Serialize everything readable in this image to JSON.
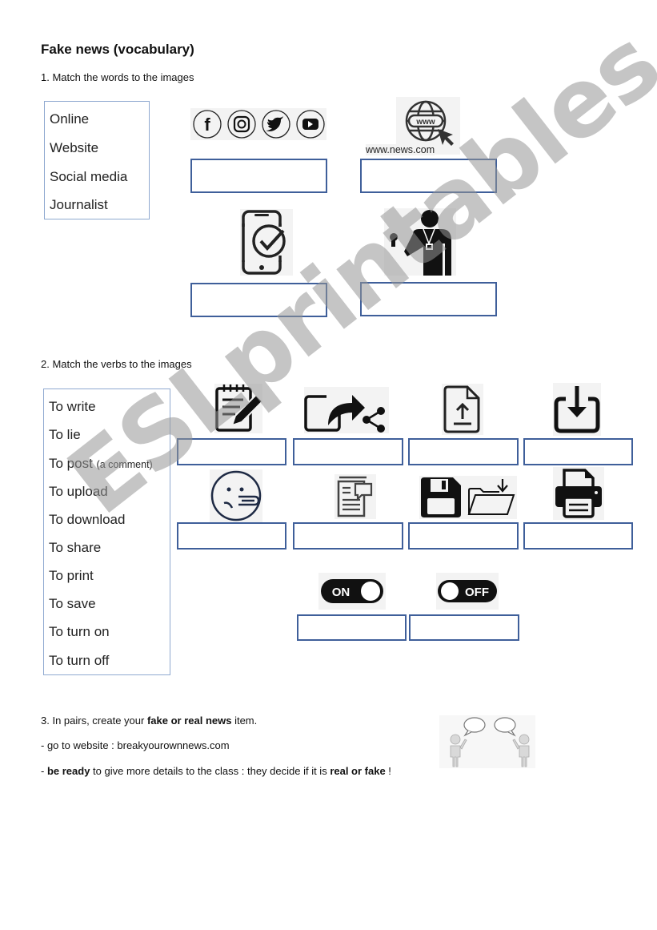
{
  "title": "Fake news (vocabulary)",
  "section1": {
    "instruction": "1. Match the words to the images",
    "words": [
      "Online",
      "Website",
      "Social media",
      "Journalist"
    ],
    "images": [
      {
        "icon": "social-media-icons",
        "caption": ""
      },
      {
        "icon": "www-globe-cursor-icon",
        "caption": "www.news.com"
      },
      {
        "icon": "phone-check-icon",
        "caption": ""
      },
      {
        "icon": "journalist-microphone-icon",
        "caption": ""
      }
    ]
  },
  "section2": {
    "instruction": "2. Match the verbs to the images",
    "verbs": [
      "To write",
      "To lie",
      "To post",
      "To upload",
      "To download",
      "To share",
      "To print",
      "To save",
      "To turn on",
      "To turn off"
    ],
    "post_note": "(a comment)",
    "images": [
      {
        "icon": "notepad-pencil-icon"
      },
      {
        "icon": "share-arrow-icon"
      },
      {
        "icon": "file-upload-icon"
      },
      {
        "icon": "download-tray-icon"
      },
      {
        "icon": "lying-face-icon"
      },
      {
        "icon": "document-comment-icon"
      },
      {
        "icon": "floppy-folder-save-icon"
      },
      {
        "icon": "printer-icon"
      },
      {
        "icon": "toggle-on-icon",
        "label": "ON"
      },
      {
        "icon": "toggle-off-icon",
        "label": "OFF"
      }
    ]
  },
  "section3": {
    "line1_pre": "3. In pairs, create your ",
    "line1_bold": "fake or real news",
    "line1_post": " item.",
    "line2": "- go to website : breakyourownnews.com",
    "line3_pre": "- ",
    "line3_bold1": "be ready",
    "line3_mid": " to give more details to the class : they decide if it is ",
    "line3_bold2": "real or fake",
    "line3_post": " !"
  },
  "watermark": "ESLprintables.com",
  "colors": {
    "box_border": "#3f5f9a",
    "wordbox_border": "#8fa9d0",
    "watermark": "#969696"
  }
}
